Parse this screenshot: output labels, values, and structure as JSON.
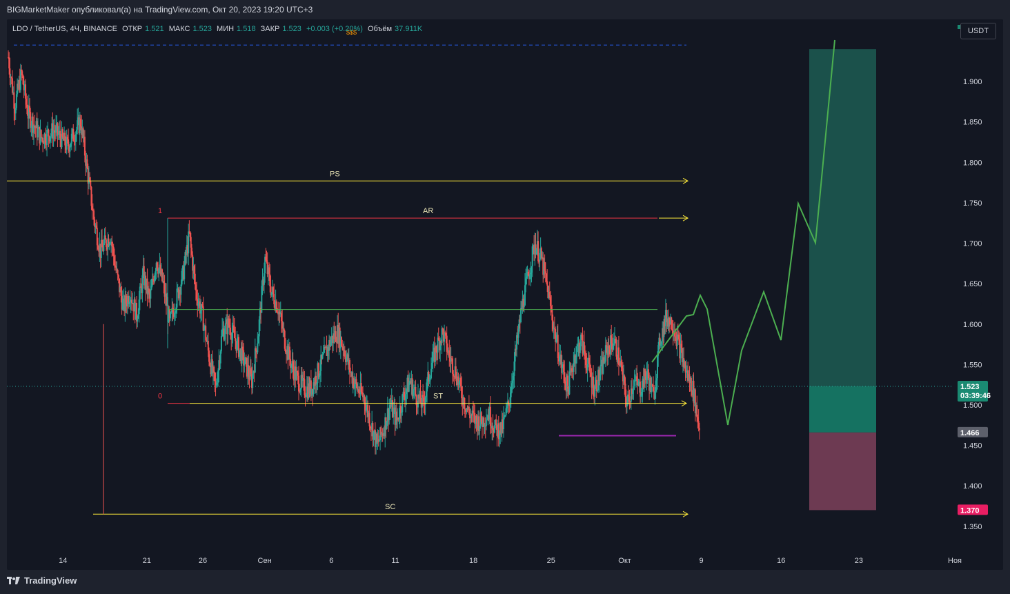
{
  "header": {
    "attribution": "BIGMarketMaker опубликовал(а) на TradingView.com, Окт 20, 2023 19:20 UTC+3"
  },
  "legend": {
    "symbol": "LDO / TetherUS, 4Ч, BINANCE",
    "open_label": "ОТКР",
    "open_value": "1.521",
    "high_label": "МАКС",
    "high_value": "1.523",
    "low_label": "МИН",
    "low_value": "1.518",
    "close_label": "ЗАКР",
    "close_value": "1.523",
    "change": "+0.003 (+0.20%)",
    "volume_label": "Объём",
    "volume_value": "37.911K",
    "sss_label": "$$$"
  },
  "currency_button": "USDT",
  "price_label": {
    "price": "1.523",
    "countdown": "03:39:46"
  },
  "footer": {
    "brand": "TradingView",
    "icon": "tradingview-logo-icon"
  },
  "colors": {
    "up": "#26a69a",
    "down": "#ef5350",
    "yellow": "#ffeb3b",
    "green_path": "#4caf50",
    "target": "#1f6b5c",
    "stop": "#6d3a52"
  },
  "chart_data": {
    "type": "candlestick",
    "symbol": "LDO / TetherUS",
    "timeframe": "4Ч",
    "exchange": "BINANCE",
    "y_axis": {
      "ticks": [
        "1.350",
        "1.400",
        "1.450",
        "1.500",
        "1.550",
        "1.600",
        "1.650",
        "1.700",
        "1.750",
        "1.800",
        "1.850",
        "1.900"
      ],
      "range": [
        1.32,
        1.97
      ]
    },
    "x_axis": {
      "ticks": [
        "14",
        "21",
        "26",
        "Сен",
        "6",
        "11",
        "18",
        "25",
        "Окт",
        "9",
        "16",
        "23",
        "Ноя"
      ]
    },
    "price_series": [
      [
        0,
        1.93
      ],
      [
        2,
        1.87
      ],
      [
        4,
        1.91
      ],
      [
        6,
        1.86
      ],
      [
        10,
        1.83
      ],
      [
        14,
        1.84
      ],
      [
        18,
        1.82
      ],
      [
        22,
        1.85
      ],
      [
        24,
        1.79
      ],
      [
        26,
        1.73
      ],
      [
        28,
        1.69
      ],
      [
        31,
        1.71
      ],
      [
        33,
        1.66
      ],
      [
        35,
        1.62
      ],
      [
        37,
        1.64
      ],
      [
        39,
        1.61
      ],
      [
        41,
        1.66
      ],
      [
        43,
        1.63
      ],
      [
        45,
        1.68
      ],
      [
        47,
        1.65
      ],
      [
        49,
        1.6
      ],
      [
        51,
        1.63
      ],
      [
        53,
        1.66
      ],
      [
        55,
        1.71
      ],
      [
        57,
        1.64
      ],
      [
        59,
        1.61
      ],
      [
        61,
        1.56
      ],
      [
        63,
        1.52
      ],
      [
        65,
        1.59
      ],
      [
        67,
        1.6
      ],
      [
        69,
        1.58
      ],
      [
        71,
        1.56
      ],
      [
        74,
        1.53
      ],
      [
        76,
        1.59
      ],
      [
        78,
        1.68
      ],
      [
        80,
        1.64
      ],
      [
        82,
        1.62
      ],
      [
        84,
        1.58
      ],
      [
        86,
        1.55
      ],
      [
        88,
        1.53
      ],
      [
        90,
        1.52
      ],
      [
        92,
        1.52
      ],
      [
        94,
        1.54
      ],
      [
        96,
        1.56
      ],
      [
        98,
        1.58
      ],
      [
        100,
        1.59
      ],
      [
        102,
        1.57
      ],
      [
        104,
        1.54
      ],
      [
        106,
        1.52
      ],
      [
        108,
        1.51
      ],
      [
        110,
        1.48
      ],
      [
        112,
        1.45
      ],
      [
        114,
        1.47
      ],
      [
        116,
        1.5
      ],
      [
        118,
        1.48
      ],
      [
        120,
        1.51
      ],
      [
        122,
        1.53
      ],
      [
        124,
        1.51
      ],
      [
        126,
        1.5
      ],
      [
        128,
        1.54
      ],
      [
        130,
        1.57
      ],
      [
        132,
        1.59
      ],
      [
        134,
        1.56
      ],
      [
        136,
        1.54
      ],
      [
        138,
        1.51
      ],
      [
        140,
        1.49
      ],
      [
        142,
        1.48
      ],
      [
        144,
        1.48
      ],
      [
        146,
        1.49
      ],
      [
        148,
        1.47
      ],
      [
        150,
        1.47
      ],
      [
        152,
        1.5
      ],
      [
        154,
        1.56
      ],
      [
        156,
        1.62
      ],
      [
        158,
        1.66
      ],
      [
        160,
        1.7
      ],
      [
        162,
        1.68
      ],
      [
        164,
        1.64
      ],
      [
        166,
        1.59
      ],
      [
        168,
        1.55
      ],
      [
        170,
        1.52
      ],
      [
        172,
        1.56
      ],
      [
        174,
        1.58
      ],
      [
        176,
        1.55
      ],
      [
        178,
        1.52
      ],
      [
        180,
        1.54
      ],
      [
        182,
        1.57
      ],
      [
        184,
        1.58
      ],
      [
        186,
        1.55
      ],
      [
        188,
        1.5
      ],
      [
        190,
        1.53
      ],
      [
        192,
        1.52
      ],
      [
        194,
        1.54
      ],
      [
        196,
        1.51
      ],
      [
        198,
        1.58
      ],
      [
        200,
        1.61
      ],
      [
        202,
        1.6
      ],
      [
        204,
        1.57
      ],
      [
        206,
        1.54
      ],
      [
        208,
        1.52
      ],
      [
        210,
        1.47
      ]
    ],
    "levels": [
      {
        "label": "PS",
        "value": 1.777
      },
      {
        "label": "AR",
        "value": 1.731
      },
      {
        "label": "ST",
        "value": 1.502
      },
      {
        "label": "SC",
        "value": 1.365
      },
      {
        "label": "1",
        "value": 1.731
      },
      {
        "label": "0",
        "value": 1.502
      },
      {
        "label": "",
        "value": 1.618
      },
      {
        "label": "",
        "value": 1.462
      },
      {
        "label": "",
        "value": 1.523
      },
      {
        "label": "",
        "value": 1.945
      }
    ],
    "projection": [
      [
        162,
        1.57
      ],
      [
        166,
        1.61
      ],
      [
        168,
        1.6
      ],
      [
        172,
        1.62
      ],
      [
        178,
        1.5
      ],
      [
        182,
        1.46
      ],
      [
        186,
        1.54
      ],
      [
        190,
        1.62
      ],
      [
        194,
        1.55
      ],
      [
        198,
        1.73
      ],
      [
        202,
        1.69
      ],
      [
        206,
        1.95
      ]
    ],
    "position": {
      "entry": 1.466,
      "stop": 1.37,
      "target": 1.94,
      "current": 1.523
    },
    "axis_labels": [
      {
        "value": "1.523",
        "type": "current"
      },
      {
        "value": "1.466",
        "type": "entry"
      },
      {
        "value": "1.370",
        "type": "stop"
      }
    ]
  }
}
